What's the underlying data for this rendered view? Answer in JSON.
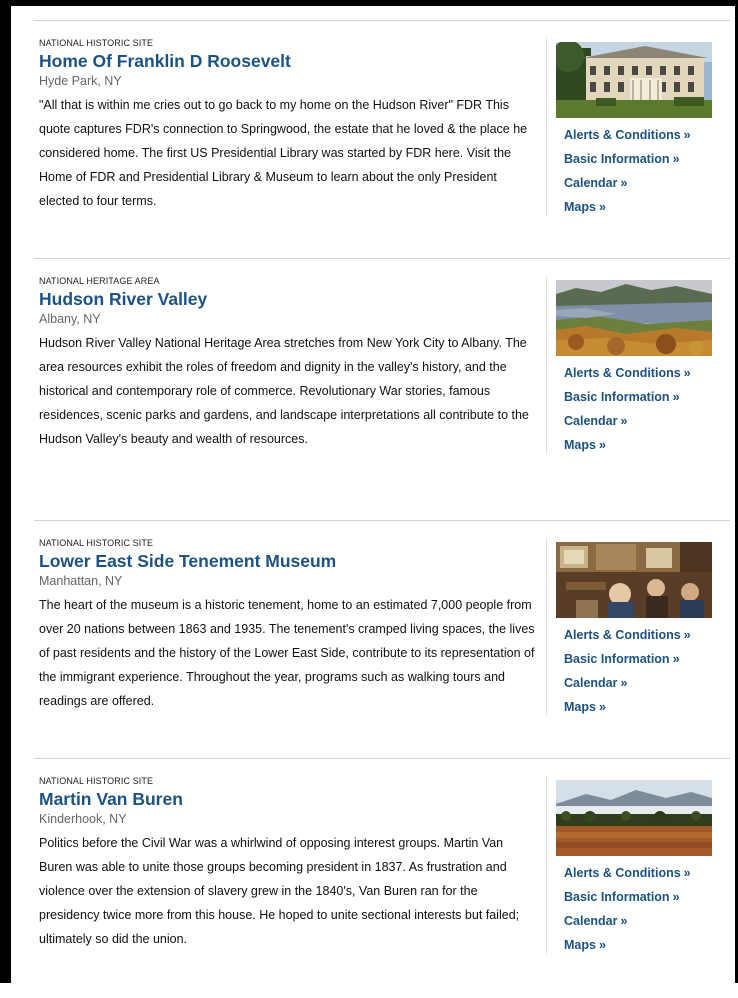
{
  "link_labels": {
    "alerts": "Alerts & Conditions",
    "basic": "Basic Information",
    "calendar": "Calendar",
    "maps": "Maps",
    "chevron": "»"
  },
  "parks": [
    {
      "designation": "National Historic Site",
      "title": "Home Of Franklin D Roosevelt",
      "location": "Hyde Park, NY",
      "description": "\"All that is within me cries out to go back to my home on the Hudson River\" FDR This quote captures FDR's connection to Springwood, the estate that he loved & the place he considered home. The first US Presidential Library was started by FDR here. Visit the Home of FDR and Presidential Library & Museum to learn about the only President elected to four terms."
    },
    {
      "designation": "National Heritage Area",
      "title": "Hudson River Valley",
      "location": "Albany, NY",
      "description": "Hudson River Valley National Heritage Area stretches from New York City to Albany. The area resources exhibit the roles of freedom and dignity in the valley's history, and the historical and contemporary role of commerce. Revolutionary War stories, famous residences, scenic parks and gardens, and landscape interpretations all contribute to the Hudson Valley's beauty and wealth of resources."
    },
    {
      "designation": "National Historic Site",
      "title": "Lower East Side Tenement Museum",
      "location": "Manhattan, NY",
      "description": "The heart of the museum is a historic tenement, home to an estimated 7,000 people from over 20 nations between 1863 and 1935. The tenement's cramped living spaces, the lives of past residents and the history of the Lower East Side, contribute to its representation of the immigrant experience. Throughout the year, programs such as walking tours and readings are offered."
    },
    {
      "designation": "National Historic Site",
      "title": "Martin Van Buren",
      "location": "Kinderhook, NY",
      "description": "Politics before the Civil War was a whirlwind of opposing interest groups. Martin Van Buren was able to unite those groups becoming president in 1837. As frustration and violence over the extension of slavery grew in the 1840's, Van Buren ran for the presidency twice more from this house. He hoped to unite sectional interests but failed; ultimately so did the union."
    }
  ],
  "colors": {
    "title_link": "#1c5284",
    "body_text": "#111111",
    "location_text": "#666666",
    "divider": "#d4d4d4"
  }
}
